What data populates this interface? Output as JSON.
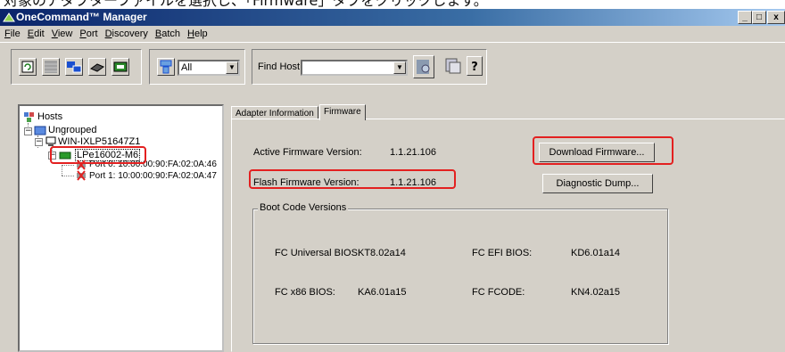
{
  "caption": "対象のアダプターファイルを選択し、「Firmware」タブをクリックします。",
  "window": {
    "title": "OneCommand™ Manager",
    "min": "_",
    "max": "□",
    "close": "x"
  },
  "menu": [
    "File",
    "Edit",
    "View",
    "Port",
    "Discovery",
    "Batch",
    "Help"
  ],
  "toolbar": {
    "filter_value": "All",
    "find_host_label": "Find Host:",
    "find_host_value": ""
  },
  "tree": {
    "root": "Hosts",
    "group": "Ungrouped",
    "host": "WIN-IXLP51647Z1",
    "adapter": "LPe16002-M6",
    "ports": [
      "Port 0: 10:00:00:90:FA:02:0A:46",
      "Port 1: 10:00:00:90:FA:02:0A:47"
    ]
  },
  "tabs": [
    "Adapter Information",
    "Firmware"
  ],
  "firmware": {
    "active_label": "Active Firmware Version:",
    "active_value": "1.1.21.106",
    "flash_label": "Flash Firmware Version:",
    "flash_value": "1.1.21.106",
    "download_button": "Download Firmware...",
    "diag_button": "Diagnostic Dump...",
    "boot_group_label": "Boot Code Versions",
    "boot": {
      "fc_universal_bios_label": "FC Universal BIOS:",
      "fc_universal_bios_value": "KT8.02a14",
      "fc_efi_bios_label": "FC EFI BIOS:",
      "fc_efi_bios_value": "KD6.01a14",
      "fc_x86_bios_label": "FC x86 BIOS:",
      "fc_x86_bios_value": "KA6.01a15",
      "fc_fcode_label": "FC FCODE:",
      "fc_fcode_value": "KN4.02a15"
    }
  },
  "colors": {
    "highlight": "#e32020",
    "title_bar": "#0a246a",
    "face": "#d4d0c8"
  }
}
